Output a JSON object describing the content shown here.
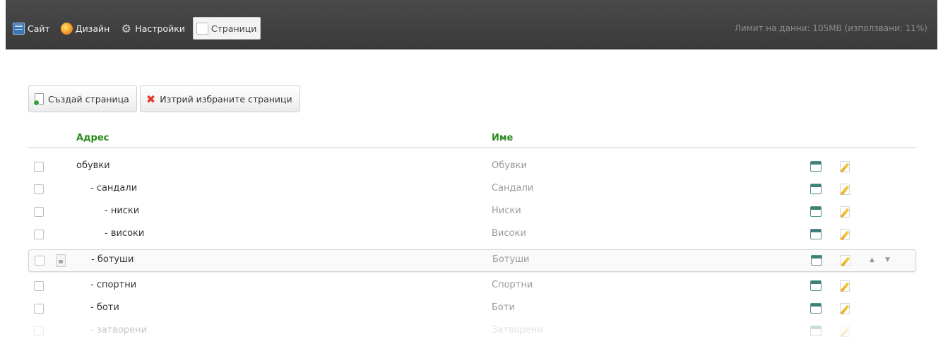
{
  "topbar": {
    "nav": [
      {
        "label": "Сайт",
        "icon": "site-icon",
        "active": false
      },
      {
        "label": "Дизайн",
        "icon": "design-palette-icon",
        "active": false
      },
      {
        "label": "Настройки",
        "icon": "gear-icon",
        "active": false
      },
      {
        "label": "Страници",
        "icon": "pages-icon",
        "active": true
      }
    ],
    "limit_text": "Лимит на данни: 105MB (използвани: 11%)"
  },
  "toolbar": {
    "create_label": "Създай страница",
    "delete_label": "Изтрий избраните страници"
  },
  "table": {
    "headers": {
      "address": "Адрес",
      "name": "Име"
    },
    "rows": [
      {
        "address": "обувки",
        "name": "Обувки",
        "level": 0
      },
      {
        "address": "- сандали",
        "name": "Сандали",
        "level": 1
      },
      {
        "address": "- ниски",
        "name": "Ниски",
        "level": 2
      },
      {
        "address": "- високи",
        "name": "Високи",
        "level": 2
      },
      {
        "address": "- ботуши",
        "name": "Ботуши",
        "level": 1,
        "highlighted": true
      },
      {
        "address": "- спортни",
        "name": "Спортни",
        "level": 1
      },
      {
        "address": "- боти",
        "name": "Боти",
        "level": 1
      },
      {
        "address": "- затворени",
        "name": "Затворени",
        "level": 1,
        "faded": true
      }
    ]
  },
  "colors": {
    "topbar": "#3f3f3f",
    "header_text": "#2a8a1e",
    "delete_icon": "#e23a2a",
    "muted_text": "#9a9a9a"
  }
}
